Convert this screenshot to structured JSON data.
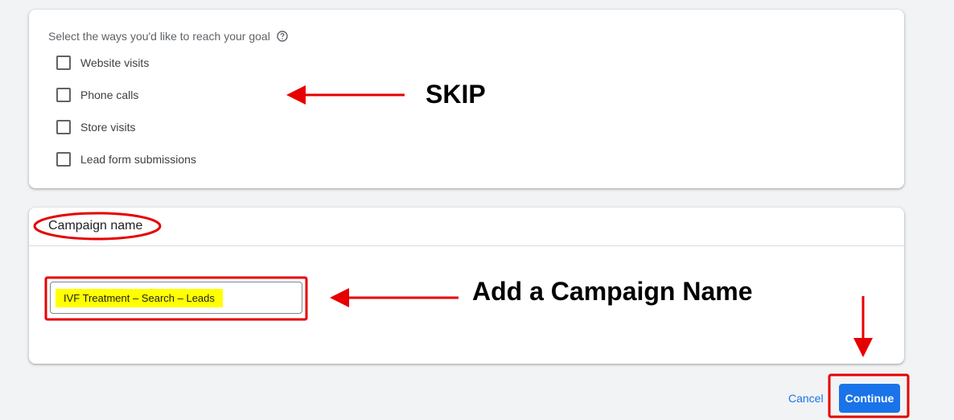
{
  "goal_card": {
    "title": "Select the ways you'd like to reach your goal",
    "help_icon": "help-circle-icon",
    "options": [
      {
        "label": "Website visits",
        "checked": false
      },
      {
        "label": "Phone calls",
        "checked": false
      },
      {
        "label": "Store visits",
        "checked": false
      },
      {
        "label": "Lead form submissions",
        "checked": false
      }
    ]
  },
  "campaign_name_card": {
    "title": "Campaign name",
    "input_value": "IVF Treatment – Search – Leads"
  },
  "footer": {
    "cancel_label": "Cancel",
    "continue_label": "Continue"
  },
  "annotations": {
    "skip": "SKIP",
    "add_name": "Add a Campaign Name",
    "color": "#e60000"
  },
  "colors": {
    "accent": "#1a73e8",
    "highlight": "#ffff00",
    "background": "#f1f3f4"
  }
}
